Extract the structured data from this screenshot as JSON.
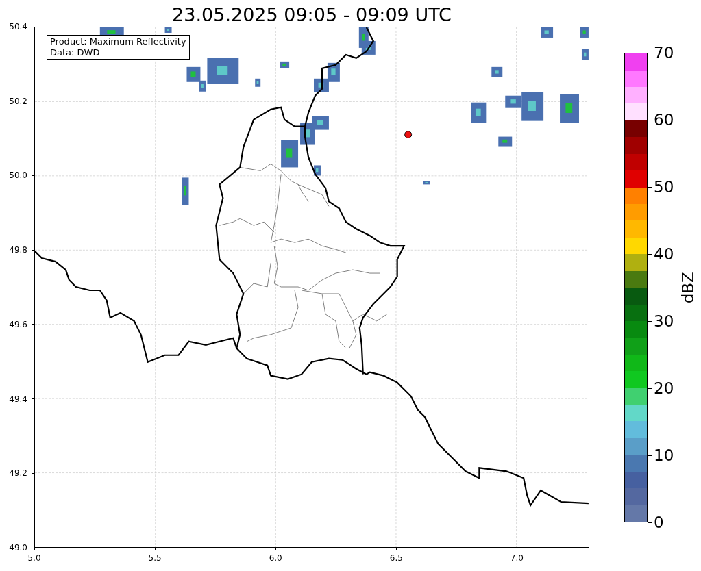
{
  "title": "23.05.2025 09:05 - 09:09 UTC",
  "map": {
    "info_box": [
      "Product: Maximum Reflectivity",
      "Data: DWD"
    ],
    "y_axis_ticks": [
      "50.4",
      "50.2",
      "50.0",
      "49.8",
      "49.6",
      "49.4",
      "49.2",
      "49.0"
    ],
    "x_axis_ticks": [
      "5.0",
      "5.5",
      "6.0",
      "6.5",
      "7.0"
    ]
  },
  "colorbar": {
    "label": "dBZ",
    "ticks": [
      "70",
      "60",
      "50",
      "40",
      "30",
      "20",
      "10",
      "0"
    ],
    "segments": [
      {
        "color": "#6478a8"
      },
      {
        "color": "#5468a0"
      },
      {
        "color": "#4660a0"
      },
      {
        "color": "#4a78b0"
      },
      {
        "color": "#5a9ec8"
      },
      {
        "color": "#62bcdc"
      },
      {
        "color": "#62d8c8"
      },
      {
        "color": "#40d070"
      },
      {
        "color": "#10c820"
      },
      {
        "color": "#10b818"
      },
      {
        "color": "#10a018"
      },
      {
        "color": "#088a10"
      },
      {
        "color": "#087010"
      },
      {
        "color": "#085a10"
      },
      {
        "color": "#4a7a10"
      },
      {
        "color": "#b0b010"
      },
      {
        "color": "#ffd800"
      },
      {
        "color": "#ffb800"
      },
      {
        "color": "#ff9c00"
      },
      {
        "color": "#ff8000"
      },
      {
        "color": "#e00000"
      },
      {
        "color": "#c00000"
      },
      {
        "color": "#a00000"
      },
      {
        "color": "#780000"
      },
      {
        "color": "#ffe0ff"
      },
      {
        "color": "#ffb0ff"
      },
      {
        "color": "#ff78ff"
      },
      {
        "color": "#f040f0"
      }
    ]
  }
}
